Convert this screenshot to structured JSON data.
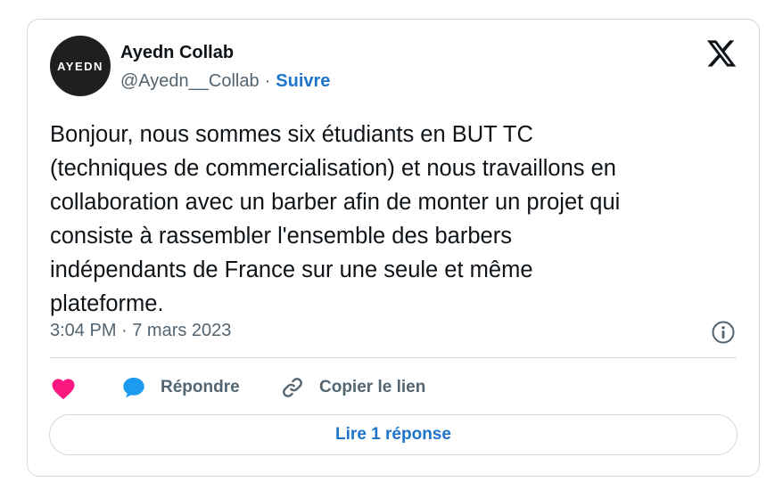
{
  "author": {
    "avatar_text": "AYEDN",
    "display_name": "Ayedn Collab",
    "handle": "@Ayedn__Collab",
    "separator": "·",
    "follow_label": "Suivre"
  },
  "tweet": {
    "text": "Bonjour, nous sommes six étudiants en BUT TC\n(techniques de commercialisation) et nous travaillons en\ncollaboration avec un barber afin de monter un projet qui\nconsiste à rassembler l'ensemble des barbers\nindépendants de France sur une seule et même\nplateforme.",
    "timestamp": "3:04 PM · 7 mars 2023"
  },
  "actions": {
    "reply_label": "Répondre",
    "copy_link_label": "Copier le lien"
  },
  "read_replies_label": "Lire 1 réponse",
  "icons": {
    "platform": "x-logo-icon",
    "info": "info-icon",
    "like": "heart-icon",
    "reply": "speech-bubble-icon",
    "copy_link": "link-icon"
  },
  "colors": {
    "accent_blue": "#1d74c9",
    "heart_pink": "#f91880",
    "reply_blue": "#1d9bf0",
    "secondary_text": "#536471",
    "border": "#cfd9de"
  }
}
